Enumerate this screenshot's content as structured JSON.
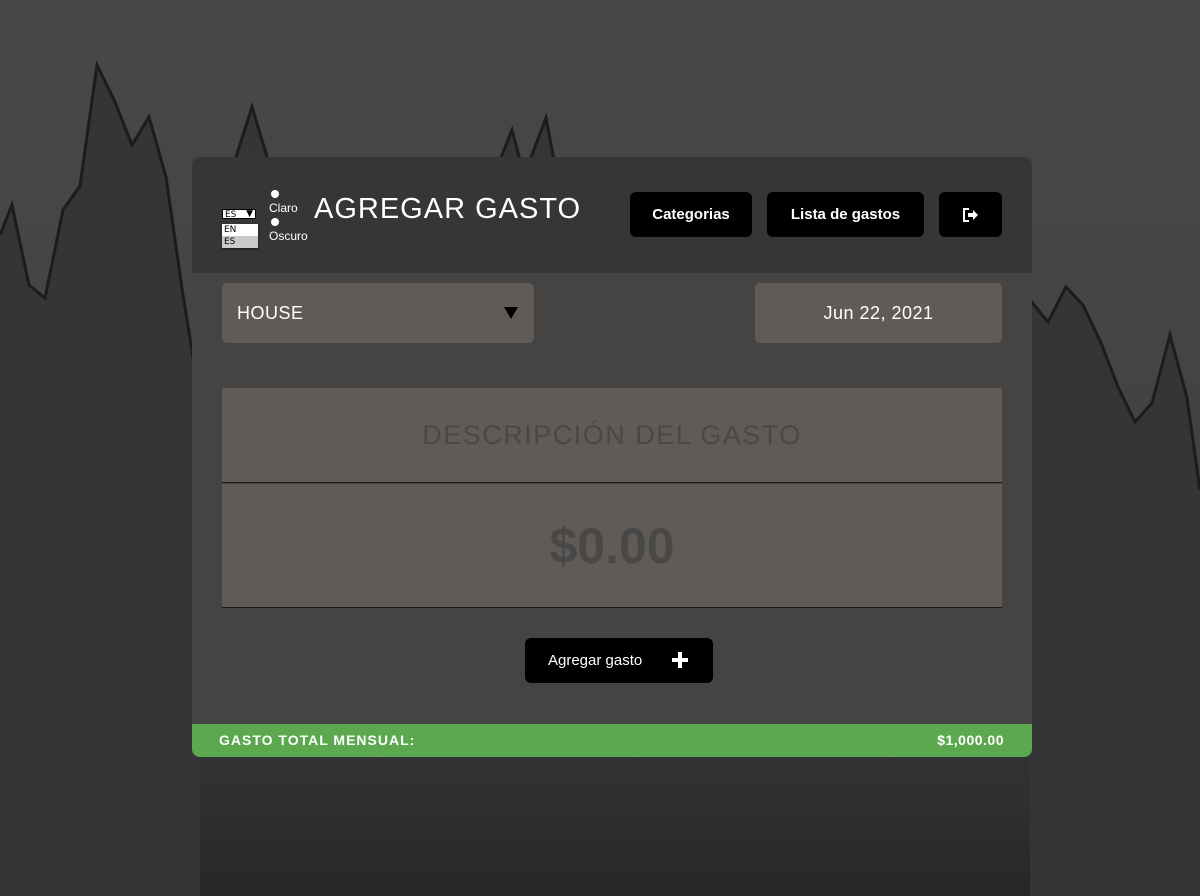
{
  "header": {
    "title": "AGREGAR GASTO",
    "language_select": {
      "selected": "ES",
      "options": [
        "EN",
        "ES"
      ]
    },
    "theme_options": {
      "light_label": "Claro",
      "dark_label": "Oscuro"
    },
    "nav": {
      "categories_label": "Categorias",
      "expense_list_label": "Lista de gastos",
      "logout_icon": "logout-icon"
    }
  },
  "form": {
    "category": "HOUSE",
    "date": "Jun 22, 2021",
    "description_placeholder": "DESCRIPCIÓN DEL GASTO",
    "amount_placeholder": "$0.00",
    "submit_label": "Agregar gasto",
    "submit_icon": "plus-icon"
  },
  "footer": {
    "label": "GASTO TOTAL MENSUAL:",
    "value": "$1,000.00"
  },
  "colors": {
    "card_background": "#464442",
    "header_background": "#383634",
    "field_background": "#5e5b59",
    "button_background": "#000000",
    "footer_accent": "#5ca84f"
  }
}
